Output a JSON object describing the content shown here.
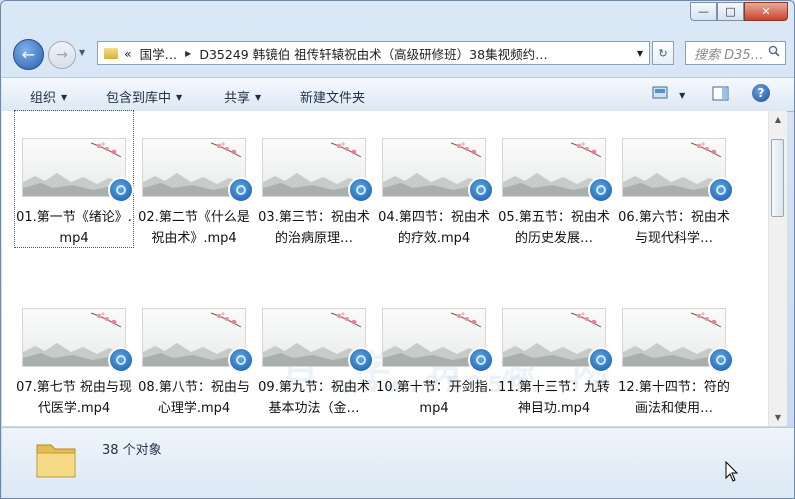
{
  "window": {
    "caption_buttons": {
      "minimize": "—",
      "maximize": "□",
      "close": "✕"
    }
  },
  "nav": {
    "back_glyph": "←",
    "forward_glyph": "→",
    "history_dropdown_glyph": "▼",
    "address": {
      "overflow": "«",
      "segments": [
        "国学…",
        "D35249 韩镜伯 祖传轩辕祝由术（高级研修班）38集视频约…"
      ],
      "separator": "▶",
      "dropdown_glyph": "▼"
    },
    "refresh_glyph": "↻",
    "search": {
      "placeholder": "搜索 D35…",
      "icon": "search-icon"
    }
  },
  "toolbar": {
    "organize": "组织",
    "include_in_library": "包含到库中",
    "share": "共享",
    "new_folder": "新建文件夹",
    "dropdown_glyph": "▼",
    "view_options_icon": "view-options-icon",
    "preview_pane_icon": "preview-pane-icon",
    "help_glyph": "?"
  },
  "files": [
    {
      "name": "01.第一节《绪论》.mp4",
      "selected": true
    },
    {
      "name": "02.第二节《什么是祝由术》.mp4"
    },
    {
      "name": "03.第三节：祝由术的治病原理…"
    },
    {
      "name": "04.第四节：祝由术的疗效.mp4"
    },
    {
      "name": "05.第五节：祝由术的历史发展…"
    },
    {
      "name": "06.第六节：祝由术与现代科学…"
    },
    {
      "name": "07.第七节 祝由与现代医学.mp4"
    },
    {
      "name": "08.第八节：祝由与心理学.mp4"
    },
    {
      "name": "09.第九节：祝由术基本功法（金…"
    },
    {
      "name": "10.第十节：开剑指.mp4"
    },
    {
      "name": "11.第十三节：九转神目功.mp4"
    },
    {
      "name": "12.第十四节：符的画法和使用…"
    }
  ],
  "scrollbar": {
    "up_glyph": "▲",
    "down_glyph": "▼"
  },
  "status": {
    "count_text": "38 个对象"
  },
  "watermark": {
    "line1": "百 学 资 源 网",
    "line2": "www.95959.com"
  },
  "colors": {
    "accent": "#2b5fad",
    "close": "#c7452f",
    "selection_outline": "#555555"
  }
}
